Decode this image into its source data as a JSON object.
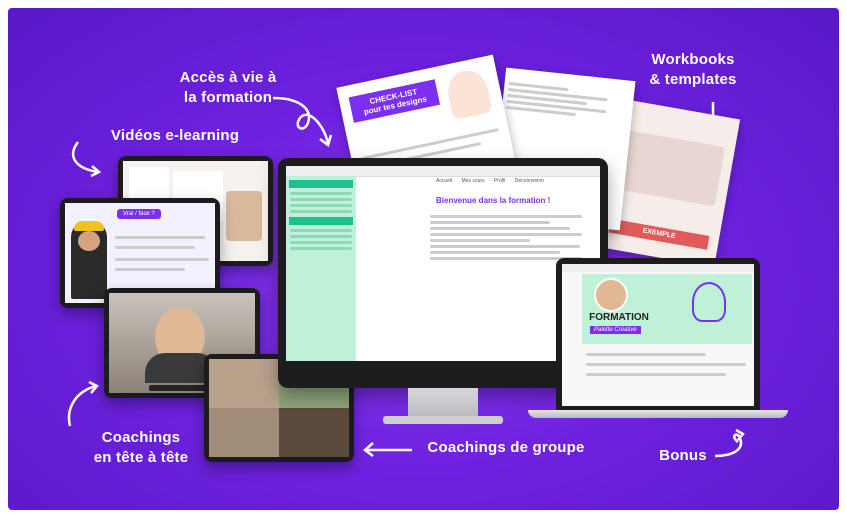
{
  "labels": {
    "acces": "Accès à vie à\nla formation",
    "videos": "Vidéos e-learning",
    "workbooks": "Workbooks\n& templates",
    "coachings_tete": "Coachings\nen tête à tête",
    "coachings_groupe": "Coachings de groupe",
    "bonus": "Bonus"
  },
  "workbook": {
    "checklist_title": "CHECK-LIST\npour tes designs",
    "slogan": "EXEMPLE"
  },
  "imac": {
    "course_title": "Bienvenue dans la formation !",
    "nav_tabs": [
      "Accueil",
      "Mes cours",
      "Profil",
      "Déconnexion"
    ]
  },
  "laptop": {
    "banner_title": "FORMATION",
    "banner_subtitle": "Palette Créative"
  },
  "ipad": {
    "quiz_badge": "Vrai / faux ?"
  },
  "colors": {
    "accent": "#7b2ff0",
    "mint": "#bff0d8",
    "green_sidebar": "#1fbf8f"
  }
}
